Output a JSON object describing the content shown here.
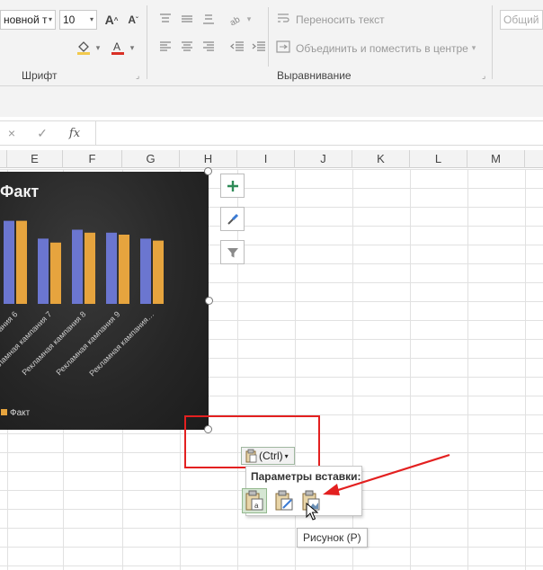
{
  "ribbon": {
    "font_name": "новной т",
    "font_size": "10",
    "font_group_label": "Шрифт",
    "wrap_text_label": "Переносить текст",
    "merge_label": "Объединить и поместить в центре",
    "align_group_label": "Выравнивание",
    "number_format": "Общий",
    "icons": [
      "increase-font-icon",
      "decrease-font-icon",
      "fill-color-icon",
      "font-color-icon",
      "align-top-icon",
      "align-middle-icon",
      "align-bottom-icon",
      "orientation-icon",
      "align-left-icon",
      "align-center-icon",
      "align-right-icon",
      "decrease-indent-icon",
      "increase-indent-icon",
      "wrap-text-icon",
      "merge-icon"
    ]
  },
  "formula_bar": {
    "cancel_symbol": "×",
    "enter_symbol": "✓",
    "fx_label": "fx",
    "value": ""
  },
  "columns": [
    "E",
    "F",
    "G",
    "H",
    "I",
    "J",
    "K",
    "L",
    "M"
  ],
  "chart_data": {
    "type": "bar",
    "title": "Факт",
    "categories": [
      "…5",
      "Рекламная кампания 6",
      "Рекламная кампания 7",
      "Рекламная кампания 8",
      "Рекламная кампания 9",
      "Рекламная кампания…"
    ],
    "series": [
      {
        "name": "",
        "color": "#6b76d0",
        "values": [
          0,
          84,
          66,
          75,
          72,
          66
        ]
      },
      {
        "name": "Факт",
        "color": "#e6a43e",
        "values": [
          86,
          84,
          62,
          72,
          70,
          64
        ]
      }
    ],
    "legend": [
      "Факт"
    ],
    "legend_position": "bottom",
    "ylim": [
      0,
      100
    ],
    "grid": false
  },
  "chart_side_buttons": [
    "chart-elements-icon",
    "chart-styles-icon",
    "chart-filters-icon"
  ],
  "paste": {
    "ctrl_label": "(Ctrl)",
    "panel_title": "Параметры вставки:",
    "options": [
      "paste-keep-formatting-icon",
      "paste-destination-theme-icon",
      "paste-picture-icon"
    ],
    "selected": 0,
    "tooltip": "Рисунок (Р)"
  },
  "colors": {
    "annotation_red": "#e32020",
    "series_blue": "#6b76d0",
    "series_orange": "#e6a43e"
  }
}
